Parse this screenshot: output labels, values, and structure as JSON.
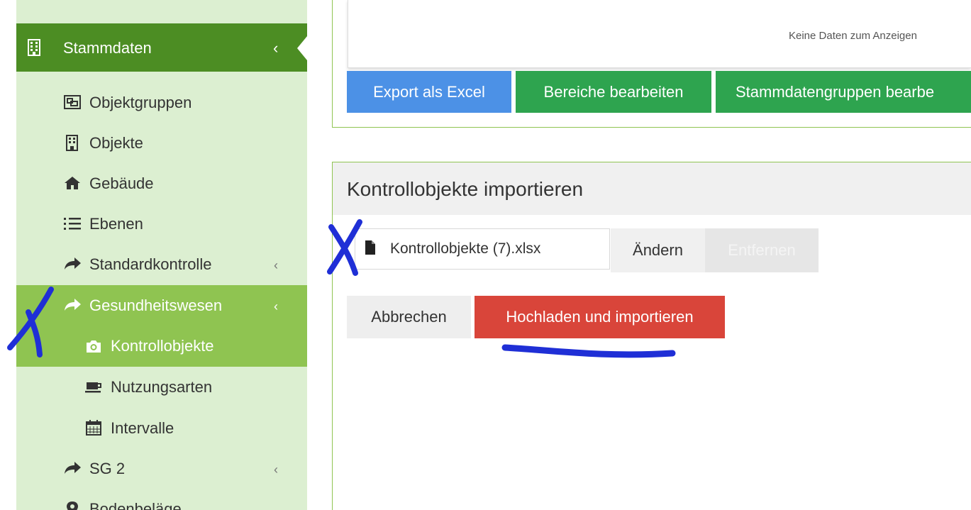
{
  "sidebar": {
    "header": {
      "label": "Stammdaten",
      "icon": "building-icon",
      "chevron": "‹"
    },
    "items": [
      {
        "label": "Objektgruppen",
        "icon": "object-group-icon",
        "chevron": ""
      },
      {
        "label": "Objekte",
        "icon": "building-icon",
        "chevron": ""
      },
      {
        "label": "Gebäude",
        "icon": "home-icon",
        "chevron": ""
      },
      {
        "label": "Ebenen",
        "icon": "list-ol-icon",
        "chevron": ""
      },
      {
        "label": "Standardkontrolle",
        "icon": "share-icon",
        "chevron": "‹"
      },
      {
        "label": "Gesundheitswesen",
        "icon": "share-icon",
        "chevron": "‹"
      },
      {
        "label": "Kontrollobjekte",
        "icon": "camera-icon",
        "chevron": ""
      },
      {
        "label": "Nutzungsarten",
        "icon": "coffee-icon",
        "chevron": ""
      },
      {
        "label": "Intervalle",
        "icon": "calendar-icon",
        "chevron": ""
      },
      {
        "label": "SG 2",
        "icon": "share-icon",
        "chevron": "‹"
      },
      {
        "label": "Bodenbeläge",
        "icon": "map-marker-icon",
        "chevron": ""
      }
    ]
  },
  "grid": {
    "empty_text": "Keine Daten zum Anzeigen"
  },
  "toolbar": {
    "export_label": "Export als Excel",
    "bereiche_label": "Bereiche bearbeiten",
    "stammgruppen_label": "Stammdatengruppen bearbe"
  },
  "import": {
    "title": "Kontrollobjekte importieren",
    "file_name": "Kontrollobjekte (7).xlsx",
    "change_label": "Ändern",
    "remove_label": "Entfernen",
    "cancel_label": "Abbrechen",
    "upload_label": "Hochladen und importieren"
  },
  "colors": {
    "nav_dark": "#4c8d23",
    "nav_light": "#dcefd1",
    "nav_active": "#8fc451",
    "primary": "#4c91e6",
    "success": "#2ea44f",
    "danger": "#d9453a",
    "annotation": "#1f2fd6"
  }
}
